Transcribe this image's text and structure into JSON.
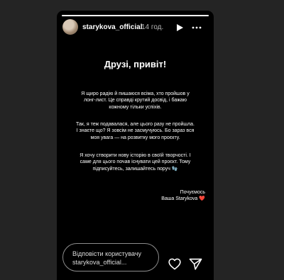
{
  "story": {
    "progress": 1.0,
    "username": "starykova_official",
    "time": "14 год."
  },
  "content": {
    "title": "Друзі, привіт!",
    "paragraph1": "Я щиро радію й пишаюся всіма, хто пройшов у лонг-лист. Це справді крутий досвід, і бажаю кожному тільки успіхів.",
    "paragraph2": "Так, я теж подавалася, але цього разу не пройшла. І знаєте що? Я зовсім не засмучуюсь. Бо зараз вся моя увага — на розвитку мого проєкту.",
    "paragraph3": "Я хочу створити нову історію в своїй творчості. І саме для цього почав існувати цей проєкт. Тому підписуйтесь, залишайтесь поруч",
    "paragraph3_emoji": "🧤",
    "sign_line1": "Почуємось",
    "sign_line2": "Ваша Starykova",
    "sign_heart": "❤️"
  },
  "footer": {
    "reply_placeholder": "Відповісти користувачу starykova_official..."
  },
  "icons": {
    "play": "play-icon",
    "more": "more-icon",
    "like": "heart-icon",
    "share": "send-icon"
  }
}
